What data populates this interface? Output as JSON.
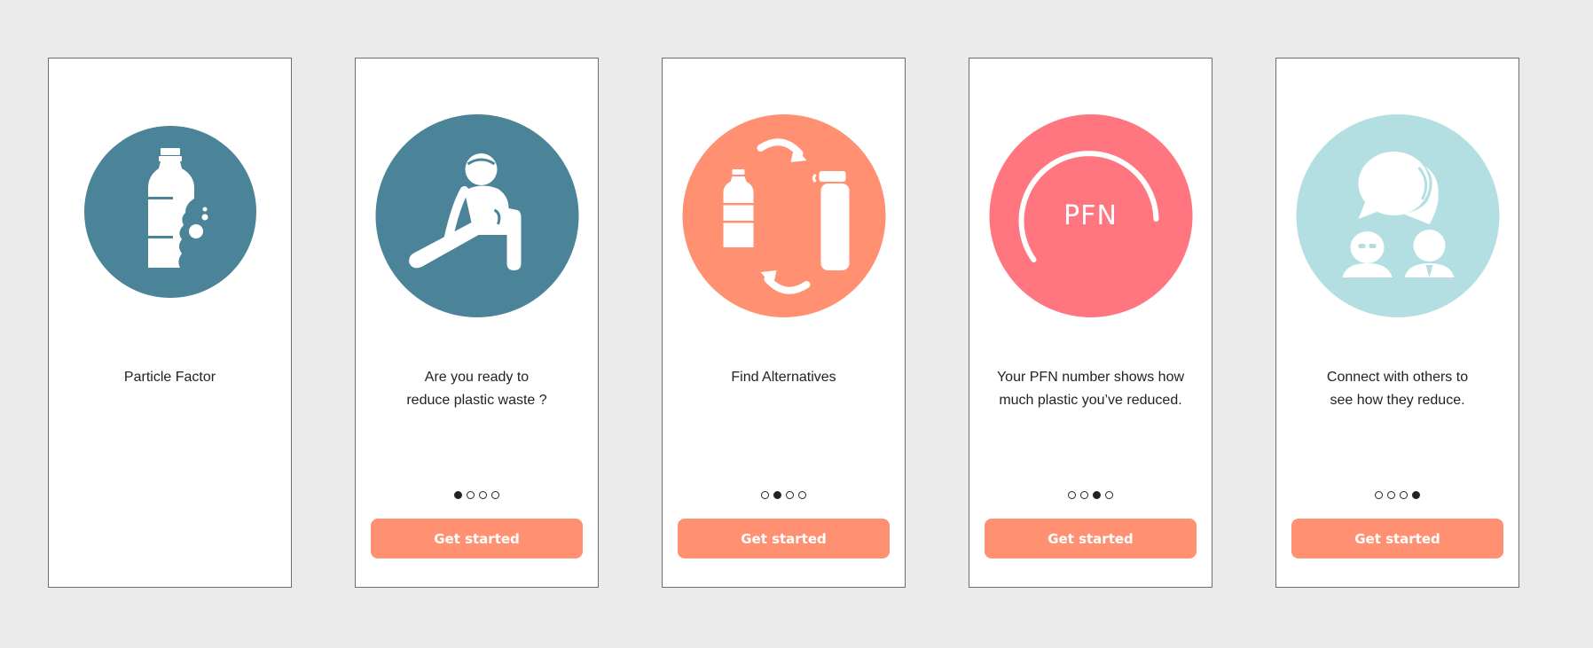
{
  "colors": {
    "background": "#ebebeb",
    "teal": "#4b8499",
    "salmon": "#ff9072",
    "coral": "#ff7680",
    "light_blue": "#b3dfe2",
    "button": "#ff9072"
  },
  "screens": [
    {
      "icon": "plastic-bottle-icon",
      "caption_lines": [
        "Particle Factor"
      ]
    },
    {
      "icon": "person-sitting-icon",
      "caption_lines": [
        "Are you ready to",
        "reduce plastic waste ?"
      ],
      "active_page": 1,
      "button_label": "Get started"
    },
    {
      "icon": "swap-bottle-icon",
      "caption_lines": [
        "Find Alternatives"
      ],
      "active_page": 2,
      "button_label": "Get started"
    },
    {
      "icon": "pfn-gauge-icon",
      "gauge_label": "PFN",
      "caption_lines": [
        "Your PFN number shows how",
        "much plastic you’ve reduced."
      ],
      "active_page": 3,
      "button_label": "Get started"
    },
    {
      "icon": "community-chat-icon",
      "caption_lines": [
        "Connect with others to",
        "see how they reduce."
      ],
      "active_page": 4,
      "button_label": "Get started"
    }
  ],
  "pagination_total": 4
}
